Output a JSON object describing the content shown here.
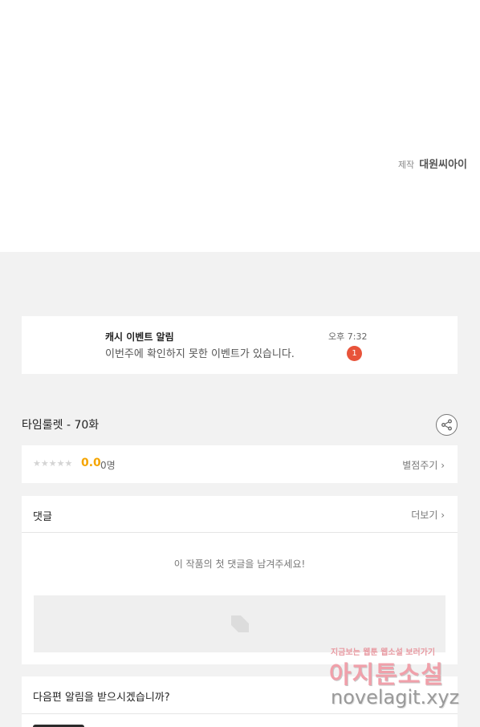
{
  "credit": {
    "label": "제작",
    "value": "대원씨아이"
  },
  "notification": {
    "title": "캐시 이벤트 알림",
    "message": "이번주에 확인하지 못한 이벤트가 있습니다.",
    "time": "오후 7:32",
    "badge": "1"
  },
  "episode": {
    "title": "타임룰렛 - 70화"
  },
  "rating": {
    "stars": "★★★★★",
    "score": "0.0",
    "count": "0명",
    "give_label": "별점주기 ›"
  },
  "comments": {
    "title": "댓글",
    "more_label": "더보기 ›",
    "empty_text": "이 작품의 첫 댓글을 남겨주세요!"
  },
  "next_episode": {
    "question": "다음편 알림을 받으시겠습니까?"
  },
  "watermark": {
    "line1": "지금보는 웹툰 웹소설 보러가기",
    "line2": "아지툰소설",
    "line3": "novelagit.xyz"
  },
  "colors": {
    "accent": "#f5a500",
    "badge": "#e8533a",
    "background": "#f2f2f2"
  },
  "icons": {
    "share": "share-icon",
    "pen": "pen-icon",
    "star": "star-icon"
  }
}
